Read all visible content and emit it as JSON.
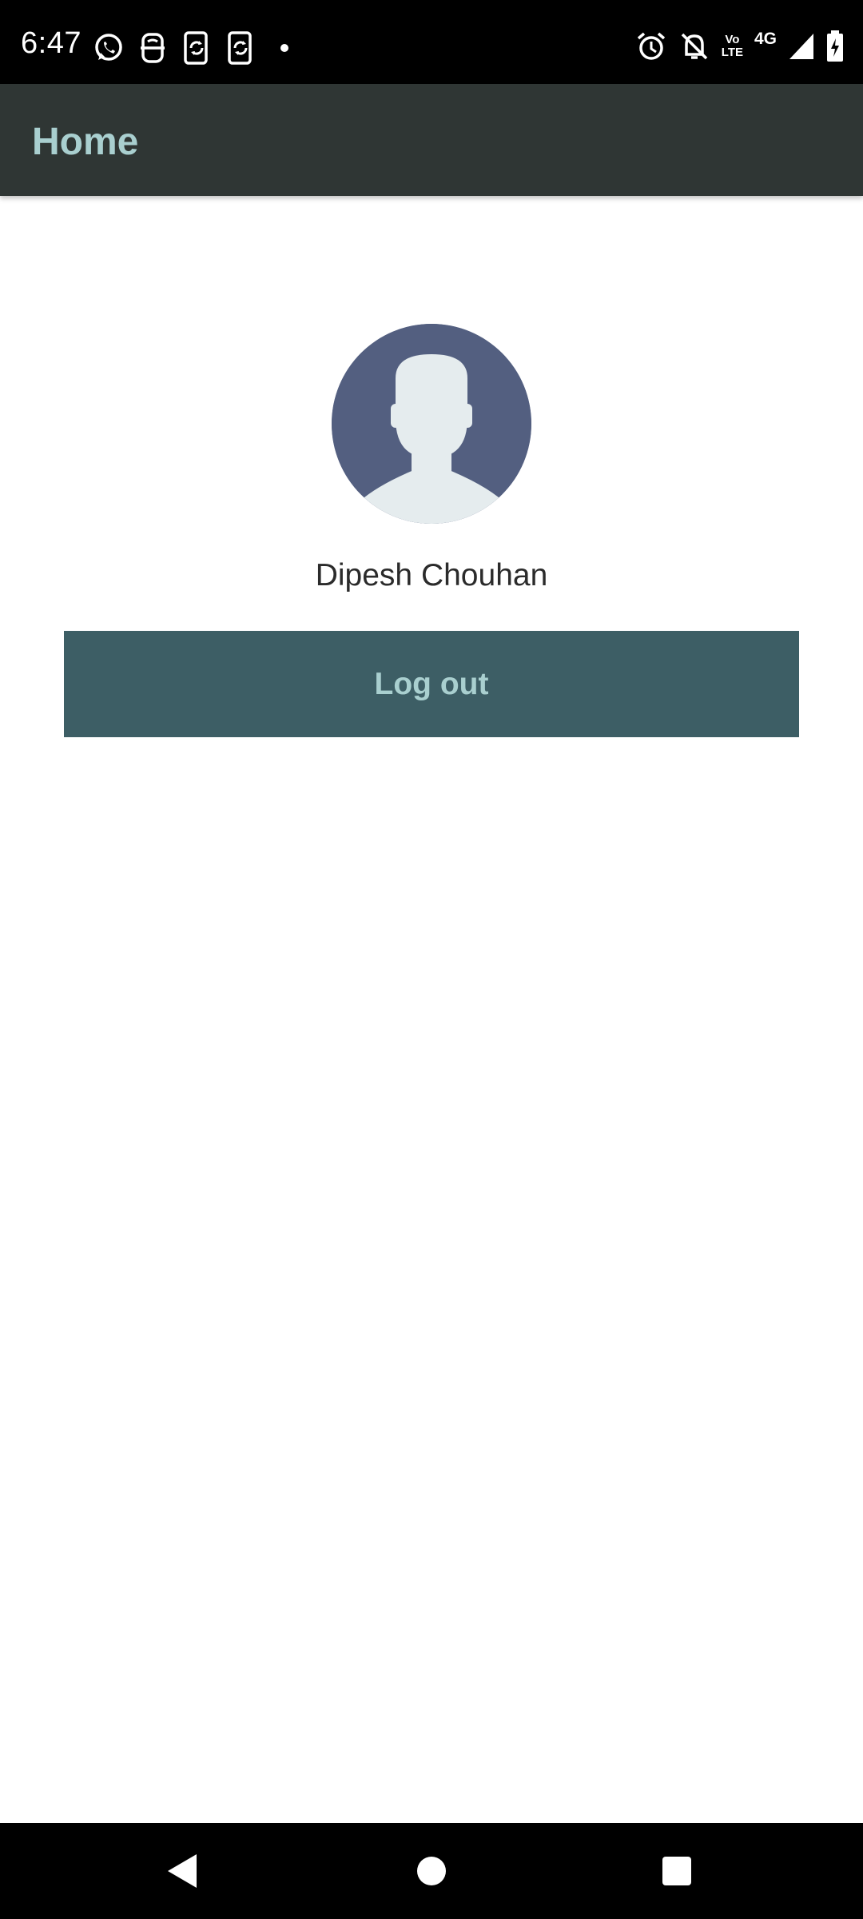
{
  "status_bar": {
    "time": "6:47",
    "left_icons": [
      "whatsapp-icon",
      "app-notification-icon",
      "phone-sync-icon",
      "phone-sync-icon",
      "more-dot-icon"
    ],
    "right_icons": [
      "alarm-icon",
      "notifications-off-icon",
      "volte-icon",
      "network-4g-icon",
      "signal-icon",
      "battery-charging-icon"
    ],
    "volte_label_top": "Vo",
    "volte_label_bottom": "LTE",
    "network_label": "4G"
  },
  "app_bar": {
    "title": "Home"
  },
  "profile": {
    "name": "Dipesh Chouhan",
    "avatar_icon": "default-user-avatar-icon"
  },
  "actions": {
    "logout_label": "Log out"
  },
  "colors": {
    "app_bar_bg": "#2f3634",
    "accent_text": "#a9cfcf",
    "button_bg": "#3d5e65",
    "avatar_bg": "#535f80"
  },
  "nav_bar": {
    "buttons": [
      "back-icon",
      "home-icon",
      "recents-icon"
    ]
  }
}
